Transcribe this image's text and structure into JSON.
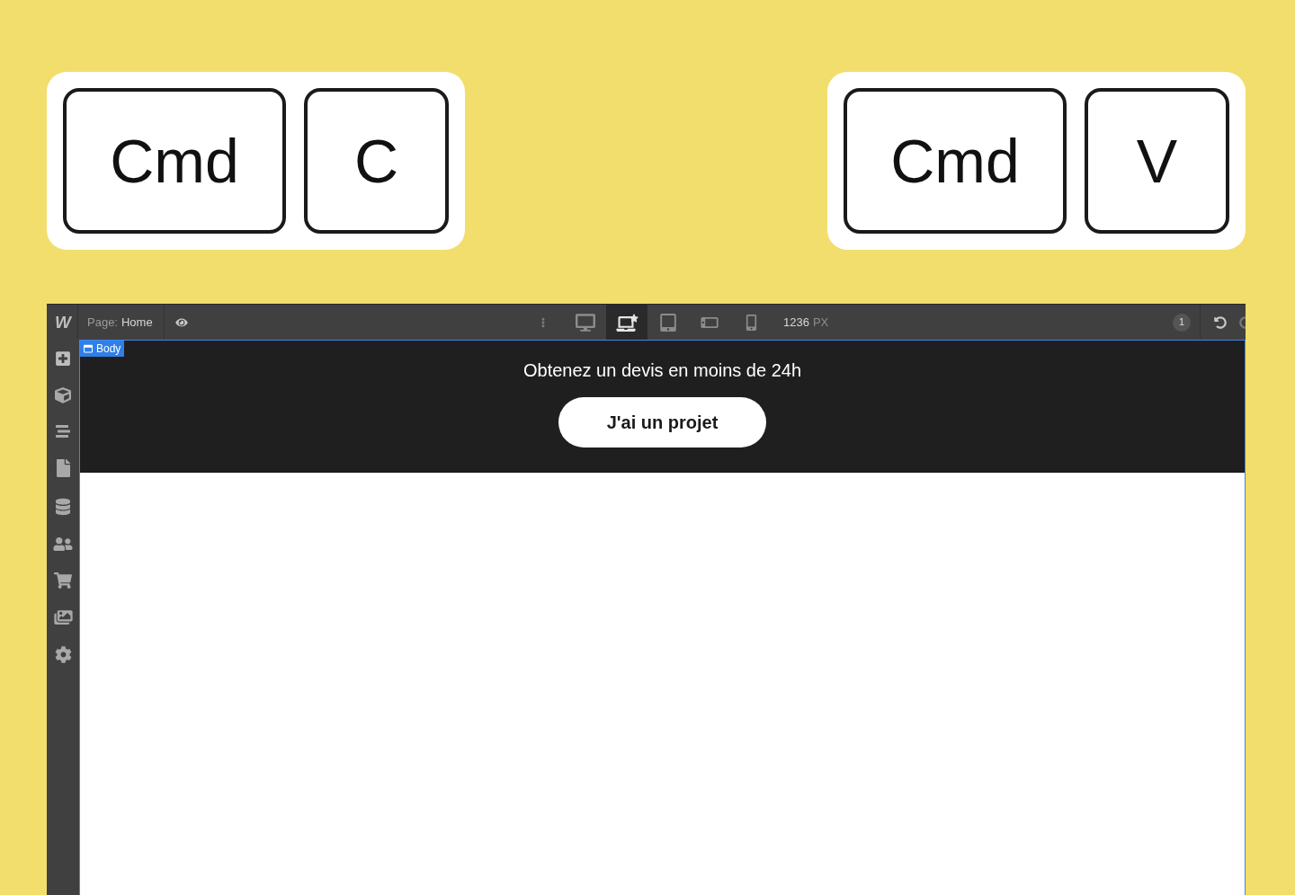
{
  "shortcuts": [
    {
      "keys": [
        {
          "kind": "modifier",
          "label": "Cmd"
        },
        {
          "kind": "letter",
          "label": "C"
        }
      ]
    },
    {
      "keys": [
        {
          "kind": "modifier",
          "label": "Cmd"
        },
        {
          "kind": "letter",
          "label": "V"
        }
      ]
    }
  ],
  "editor": {
    "logo": "W",
    "page": {
      "label": "Page:",
      "name": "Home"
    },
    "devices": [
      {
        "kind": "desktop",
        "selected": false
      },
      {
        "kind": "laptop",
        "selected": true
      },
      {
        "kind": "tablet",
        "selected": false
      },
      {
        "kind": "phone_landscape",
        "selected": false
      },
      {
        "kind": "phone_portrait",
        "selected": false
      }
    ],
    "canvas_width": {
      "value": "1236",
      "unit": "PX"
    },
    "notification_count": "1",
    "selection_tag": "Body",
    "canvas": {
      "heading": "Obtenez un devis en moins de 24h",
      "button": "J'ai un projet"
    }
  }
}
